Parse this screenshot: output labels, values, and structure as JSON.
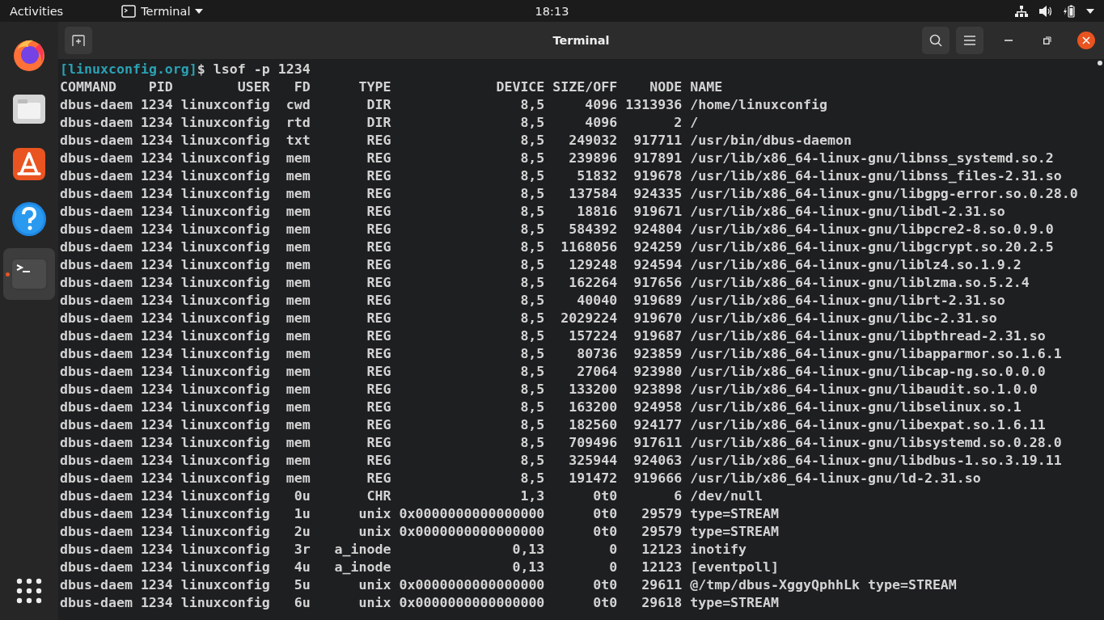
{
  "top_bar": {
    "activities": "Activities",
    "app_menu": "Terminal",
    "clock": "18:13"
  },
  "dock": {
    "items": [
      {
        "kind": "browser",
        "selected": false,
        "running": false
      },
      {
        "kind": "files",
        "selected": false,
        "running": false
      },
      {
        "kind": "store",
        "selected": false,
        "running": false
      },
      {
        "kind": "help",
        "selected": false,
        "running": false
      },
      {
        "kind": "terminal",
        "selected": true,
        "running": true
      }
    ]
  },
  "window": {
    "title": "Terminal"
  },
  "terminal": {
    "prompt": "[linuxconfig.org]",
    "command": "$ lsof -p 1234",
    "columns": [
      "COMMAND",
      "PID",
      "USER",
      "FD",
      "TYPE",
      "DEVICE",
      "SIZE/OFF",
      "NODE",
      "NAME"
    ],
    "rows": [
      [
        "dbus-daem",
        "1234",
        "linuxconfig",
        "cwd",
        "DIR",
        "8,5",
        "4096",
        "1313936",
        "/home/linuxconfig"
      ],
      [
        "dbus-daem",
        "1234",
        "linuxconfig",
        "rtd",
        "DIR",
        "8,5",
        "4096",
        "2",
        "/"
      ],
      [
        "dbus-daem",
        "1234",
        "linuxconfig",
        "txt",
        "REG",
        "8,5",
        "249032",
        "917711",
        "/usr/bin/dbus-daemon"
      ],
      [
        "dbus-daem",
        "1234",
        "linuxconfig",
        "mem",
        "REG",
        "8,5",
        "239896",
        "917891",
        "/usr/lib/x86_64-linux-gnu/libnss_systemd.so.2"
      ],
      [
        "dbus-daem",
        "1234",
        "linuxconfig",
        "mem",
        "REG",
        "8,5",
        "51832",
        "919678",
        "/usr/lib/x86_64-linux-gnu/libnss_files-2.31.so"
      ],
      [
        "dbus-daem",
        "1234",
        "linuxconfig",
        "mem",
        "REG",
        "8,5",
        "137584",
        "924335",
        "/usr/lib/x86_64-linux-gnu/libgpg-error.so.0.28.0"
      ],
      [
        "dbus-daem",
        "1234",
        "linuxconfig",
        "mem",
        "REG",
        "8,5",
        "18816",
        "919671",
        "/usr/lib/x86_64-linux-gnu/libdl-2.31.so"
      ],
      [
        "dbus-daem",
        "1234",
        "linuxconfig",
        "mem",
        "REG",
        "8,5",
        "584392",
        "924804",
        "/usr/lib/x86_64-linux-gnu/libpcre2-8.so.0.9.0"
      ],
      [
        "dbus-daem",
        "1234",
        "linuxconfig",
        "mem",
        "REG",
        "8,5",
        "1168056",
        "924259",
        "/usr/lib/x86_64-linux-gnu/libgcrypt.so.20.2.5"
      ],
      [
        "dbus-daem",
        "1234",
        "linuxconfig",
        "mem",
        "REG",
        "8,5",
        "129248",
        "924594",
        "/usr/lib/x86_64-linux-gnu/liblz4.so.1.9.2"
      ],
      [
        "dbus-daem",
        "1234",
        "linuxconfig",
        "mem",
        "REG",
        "8,5",
        "162264",
        "917656",
        "/usr/lib/x86_64-linux-gnu/liblzma.so.5.2.4"
      ],
      [
        "dbus-daem",
        "1234",
        "linuxconfig",
        "mem",
        "REG",
        "8,5",
        "40040",
        "919689",
        "/usr/lib/x86_64-linux-gnu/librt-2.31.so"
      ],
      [
        "dbus-daem",
        "1234",
        "linuxconfig",
        "mem",
        "REG",
        "8,5",
        "2029224",
        "919670",
        "/usr/lib/x86_64-linux-gnu/libc-2.31.so"
      ],
      [
        "dbus-daem",
        "1234",
        "linuxconfig",
        "mem",
        "REG",
        "8,5",
        "157224",
        "919687",
        "/usr/lib/x86_64-linux-gnu/libpthread-2.31.so"
      ],
      [
        "dbus-daem",
        "1234",
        "linuxconfig",
        "mem",
        "REG",
        "8,5",
        "80736",
        "923859",
        "/usr/lib/x86_64-linux-gnu/libapparmor.so.1.6.1"
      ],
      [
        "dbus-daem",
        "1234",
        "linuxconfig",
        "mem",
        "REG",
        "8,5",
        "27064",
        "923980",
        "/usr/lib/x86_64-linux-gnu/libcap-ng.so.0.0.0"
      ],
      [
        "dbus-daem",
        "1234",
        "linuxconfig",
        "mem",
        "REG",
        "8,5",
        "133200",
        "923898",
        "/usr/lib/x86_64-linux-gnu/libaudit.so.1.0.0"
      ],
      [
        "dbus-daem",
        "1234",
        "linuxconfig",
        "mem",
        "REG",
        "8,5",
        "163200",
        "924958",
        "/usr/lib/x86_64-linux-gnu/libselinux.so.1"
      ],
      [
        "dbus-daem",
        "1234",
        "linuxconfig",
        "mem",
        "REG",
        "8,5",
        "182560",
        "924177",
        "/usr/lib/x86_64-linux-gnu/libexpat.so.1.6.11"
      ],
      [
        "dbus-daem",
        "1234",
        "linuxconfig",
        "mem",
        "REG",
        "8,5",
        "709496",
        "917611",
        "/usr/lib/x86_64-linux-gnu/libsystemd.so.0.28.0"
      ],
      [
        "dbus-daem",
        "1234",
        "linuxconfig",
        "mem",
        "REG",
        "8,5",
        "325944",
        "924063",
        "/usr/lib/x86_64-linux-gnu/libdbus-1.so.3.19.11"
      ],
      [
        "dbus-daem",
        "1234",
        "linuxconfig",
        "mem",
        "REG",
        "8,5",
        "191472",
        "919666",
        "/usr/lib/x86_64-linux-gnu/ld-2.31.so"
      ],
      [
        "dbus-daem",
        "1234",
        "linuxconfig",
        "0u",
        "CHR",
        "1,3",
        "0t0",
        "6",
        "/dev/null"
      ],
      [
        "dbus-daem",
        "1234",
        "linuxconfig",
        "1u",
        "unix",
        "0x0000000000000000",
        "0t0",
        "29579",
        "type=STREAM"
      ],
      [
        "dbus-daem",
        "1234",
        "linuxconfig",
        "2u",
        "unix",
        "0x0000000000000000",
        "0t0",
        "29579",
        "type=STREAM"
      ],
      [
        "dbus-daem",
        "1234",
        "linuxconfig",
        "3r",
        "a_inode",
        "0,13",
        "0",
        "12123",
        "inotify"
      ],
      [
        "dbus-daem",
        "1234",
        "linuxconfig",
        "4u",
        "a_inode",
        "0,13",
        "0",
        "12123",
        "[eventpoll]"
      ],
      [
        "dbus-daem",
        "1234",
        "linuxconfig",
        "5u",
        "unix",
        "0x0000000000000000",
        "0t0",
        "29611",
        "@/tmp/dbus-XggyQphhLk type=STREAM"
      ],
      [
        "dbus-daem",
        "1234",
        "linuxconfig",
        "6u",
        "unix",
        "0x0000000000000000",
        "0t0",
        "29618",
        "type=STREAM"
      ]
    ]
  }
}
